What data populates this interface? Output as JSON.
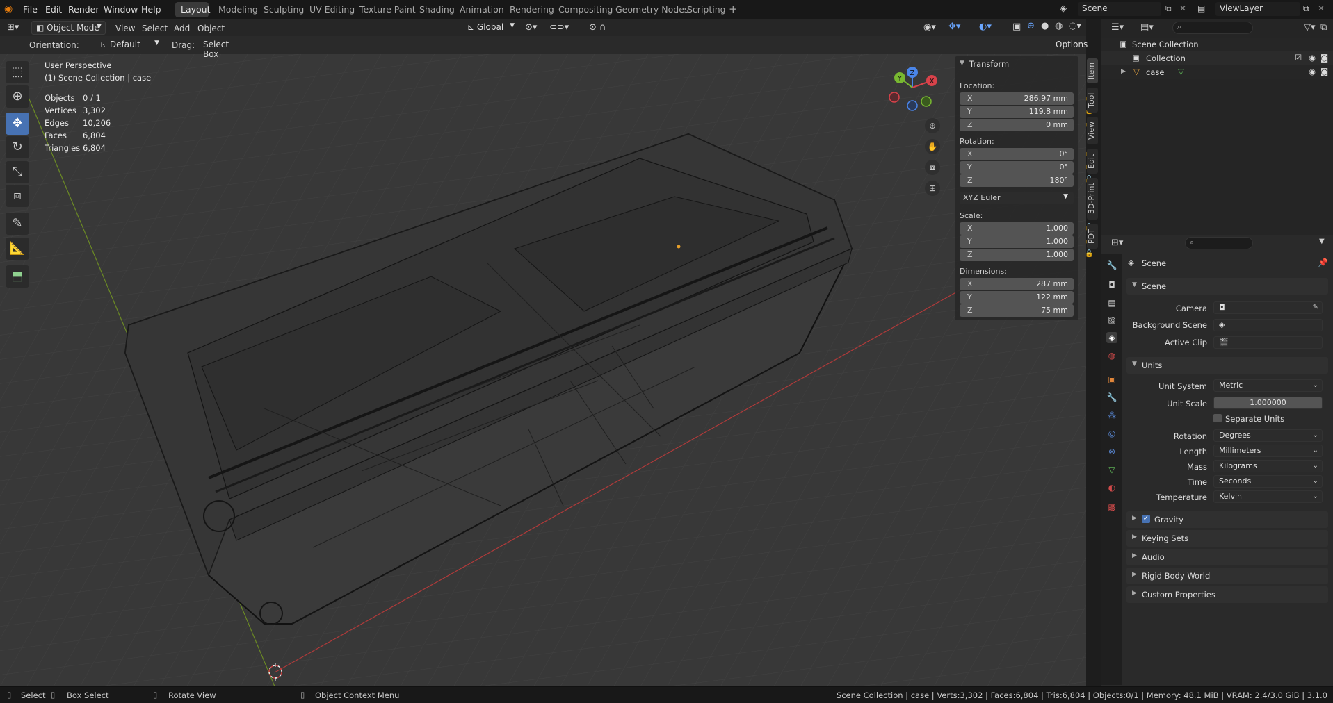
{
  "menu": [
    "File",
    "Edit",
    "Render",
    "Window",
    "Help"
  ],
  "workspaces": [
    "Layout",
    "Modeling",
    "Sculpting",
    "UV Editing",
    "Texture Paint",
    "Shading",
    "Animation",
    "Rendering",
    "Compositing",
    "Geometry Nodes",
    "Scripting"
  ],
  "scene_field": "Scene",
  "viewlayer_field": "ViewLayer",
  "header": {
    "mode": "Object Mode",
    "view": "View",
    "select": "Select",
    "add": "Add",
    "object": "Object",
    "transform": "Global"
  },
  "header2": {
    "orientation_label": "Orientation:",
    "orientation_value": "Default",
    "drag_label": "Drag:",
    "drag_value": "Select Box",
    "options": "Options"
  },
  "overlay": {
    "perspective": "User Perspective",
    "collection": "(1) Scene Collection | case",
    "stats": [
      [
        "Objects",
        "0 / 1"
      ],
      [
        "Vertices",
        "3,302"
      ],
      [
        "Edges",
        "10,206"
      ],
      [
        "Faces",
        "6,804"
      ],
      [
        "Triangles",
        "6,804"
      ]
    ]
  },
  "npanel": {
    "title": "Transform",
    "location_label": "Location:",
    "location": [
      [
        "X",
        "286.97 mm"
      ],
      [
        "Y",
        "119.8 mm"
      ],
      [
        "Z",
        "0 mm"
      ]
    ],
    "rotation_label": "Rotation:",
    "rotation": [
      [
        "X",
        "0°"
      ],
      [
        "Y",
        "0°"
      ],
      [
        "Z",
        "180°"
      ]
    ],
    "rotation_mode": "XYZ Euler",
    "scale_label": "Scale:",
    "scale": [
      [
        "X",
        "1.000"
      ],
      [
        "Y",
        "1.000"
      ],
      [
        "Z",
        "1.000"
      ]
    ],
    "dimensions_label": "Dimensions:",
    "dimensions": [
      [
        "X",
        "287 mm"
      ],
      [
        "Y",
        "122 mm"
      ],
      [
        "Z",
        "75 mm"
      ]
    ]
  },
  "sidetabs": [
    "Item",
    "Tool",
    "View",
    "Edit",
    "3D-Print",
    "PDT"
  ],
  "gizmo": {
    "x": "X",
    "y": "Y",
    "z": "Z"
  },
  "outliner": {
    "root": "Scene Collection",
    "collection": "Collection",
    "object": "case"
  },
  "props": {
    "context": "Scene",
    "scene_section": "Scene",
    "camera_label": "Camera",
    "bg_scene_label": "Background Scene",
    "active_clip_label": "Active Clip",
    "units_section": "Units",
    "unit_system_label": "Unit System",
    "unit_system": "Metric",
    "unit_scale_label": "Unit Scale",
    "unit_scale": "1.000000",
    "separate_units": "Separate Units",
    "rotation_label": "Rotation",
    "rotation": "Degrees",
    "length_label": "Length",
    "length": "Millimeters",
    "mass_label": "Mass",
    "mass": "Kilograms",
    "time_label": "Time",
    "time": "Seconds",
    "temperature_label": "Temperature",
    "temperature": "Kelvin",
    "sections": [
      "Gravity",
      "Keying Sets",
      "Audio",
      "Rigid Body World",
      "Custom Properties"
    ]
  },
  "status": {
    "select": "Select",
    "box_select": "Box Select",
    "rotate": "Rotate View",
    "context_menu": "Object Context Menu",
    "info": "Scene Collection | case | Verts:3,302 | Faces:6,804 | Tris:6,804 | Objects:0/1 | Memory: 48.1 MiB | VRAM: 2.4/3.0 GiB | 3.1.0"
  }
}
